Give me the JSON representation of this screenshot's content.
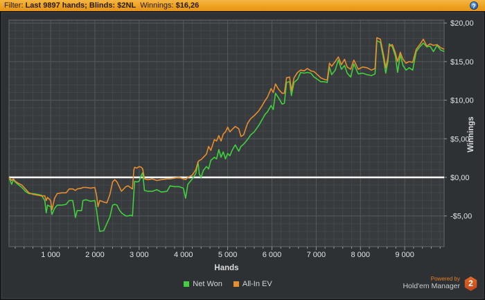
{
  "header": {
    "filter_label": "Filter: ",
    "filter_value": "Last 9897 hands; Blinds: $2NL",
    "winnings_label": "  Winnings: ",
    "winnings_value": "$16,26",
    "help_icon": "question-mark-icon",
    "bar_color": "#eda21f"
  },
  "chart_data": {
    "type": "line",
    "title": "",
    "xlabel": "Hands",
    "ylabel": "Winnings",
    "grid": true,
    "legend_position": "bottom",
    "xlim": [
      60,
      9890
    ],
    "ylim": [
      -9,
      20.4
    ],
    "x_ticks": [
      "1 000",
      "2 000",
      "3 000",
      "4 000",
      "5 000",
      "6 000",
      "7 000",
      "8 000",
      "9 000"
    ],
    "x_tick_values": [
      1000,
      2000,
      3000,
      4000,
      5000,
      6000,
      7000,
      8000,
      9000
    ],
    "y_ticks": [
      "$20,00",
      "$15,00",
      "$10,00",
      "$5,00",
      "$0,00",
      "-$5,00"
    ],
    "y_tick_values": [
      20,
      15,
      10,
      5,
      0,
      -5
    ],
    "zero_line_color": "#ffffff",
    "x": [
      60,
      120,
      160,
      200,
      280,
      350,
      430,
      510,
      600,
      700,
      790,
      870,
      900,
      930,
      1000,
      1030,
      1090,
      1150,
      1250,
      1350,
      1420,
      1500,
      1530,
      1560,
      1600,
      1700,
      1730,
      1800,
      1900,
      2000,
      2040,
      2070,
      2110,
      2200,
      2270,
      2340,
      2400,
      2450,
      2500,
      2550,
      2600,
      2650,
      2700,
      2750,
      2800,
      2850,
      2880,
      2900,
      2950,
      3000,
      3050,
      3080,
      3120,
      3200,
      3300,
      3400,
      3500,
      3630,
      3700,
      3800,
      3900,
      4000,
      4050,
      4100,
      4200,
      4280,
      4330,
      4360,
      4400,
      4450,
      4520,
      4570,
      4620,
      4700,
      4750,
      4800,
      4850,
      4900,
      4950,
      5000,
      5050,
      5100,
      5170,
      5250,
      5300,
      5360,
      5450,
      5520,
      5600,
      5700,
      5780,
      5850,
      5900,
      5980,
      6030,
      6080,
      6150,
      6230,
      6280,
      6330,
      6400,
      6440,
      6500,
      6580,
      6650,
      6730,
      6800,
      6880,
      6950,
      7030,
      7100,
      7180,
      7250,
      7300,
      7350,
      7430,
      7500,
      7570,
      7640,
      7700,
      7780,
      7850,
      7950,
      8050,
      8150,
      8250,
      8330,
      8370,
      8450,
      8530,
      8570,
      8620,
      8650,
      8720,
      8790,
      8840,
      8900,
      8960,
      9030,
      9100,
      9180,
      9260,
      9340,
      9420,
      9500,
      9570,
      9650,
      9730,
      9810,
      9890
    ],
    "series": [
      {
        "name": "Net Won",
        "color": "#41d13d",
        "values": [
          0.0,
          -0.9,
          -0.3,
          -0.6,
          -1.0,
          -1.3,
          -1.8,
          -2.1,
          -2.1,
          -2.2,
          -2.3,
          -3.0,
          -4.6,
          -3.6,
          -3.8,
          -4.8,
          -4.0,
          -3.6,
          -3.6,
          -3.5,
          -3.0,
          -3.0,
          -4.0,
          -5.2,
          -4.3,
          -4.3,
          -3.0,
          -2.9,
          -3.1,
          -3.0,
          -4.3,
          -5.6,
          -7.0,
          -6.9,
          -6.0,
          -5.1,
          -3.6,
          -3.5,
          -3.6,
          -4.2,
          -4.6,
          -4.8,
          -5.0,
          -5.0,
          -4.9,
          -5.0,
          -2.0,
          -0.5,
          -0.6,
          -0.5,
          0.3,
          0.6,
          -1.7,
          -1.8,
          -1.8,
          -1.6,
          -1.9,
          -1.8,
          -1.1,
          -1.2,
          -1.2,
          -1.4,
          -2.7,
          -0.9,
          -0.2,
          0.5,
          2.0,
          0.4,
          0.0,
          0.9,
          1.4,
          1.1,
          2.2,
          2.6,
          2.4,
          3.6,
          2.6,
          3.3,
          2.4,
          3.1,
          2.8,
          3.5,
          4.2,
          3.4,
          4.0,
          4.3,
          4.9,
          5.5,
          5.9,
          6.7,
          7.5,
          8.2,
          8.5,
          9.3,
          8.8,
          10.9,
          10.3,
          9.5,
          9.6,
          12.3,
          12.4,
          10.6,
          12.3,
          12.7,
          13.6,
          13.5,
          13.6,
          13.5,
          13.0,
          12.7,
          12.4,
          12.4,
          12.3,
          14.3,
          13.3,
          13.9,
          15.2,
          14.0,
          14.5,
          13.5,
          13.0,
          14.7,
          13.4,
          13.5,
          13.3,
          13.2,
          13.4,
          17.7,
          17.5,
          15.1,
          13.5,
          15.0,
          17.3,
          16.9,
          15.7,
          13.6,
          15.9,
          14.5,
          13.9,
          14.2,
          13.9,
          16.3,
          16.9,
          17.4,
          16.9,
          17.0,
          16.3,
          17.1,
          16.5,
          16.3
        ]
      },
      {
        "name": "All-In EV",
        "color": "#e78e2e",
        "values": [
          0.0,
          -0.4,
          -0.2,
          -0.5,
          -0.8,
          -1.0,
          -1.5,
          -2.0,
          -2.2,
          -2.3,
          -2.4,
          -2.4,
          -3.0,
          -2.6,
          -3.0,
          -4.2,
          -2.7,
          -2.1,
          -2.0,
          -2.0,
          -1.5,
          -1.5,
          -1.6,
          -1.7,
          -1.5,
          -1.4,
          -1.3,
          -1.3,
          -1.4,
          -1.3,
          -2.4,
          -3.8,
          -3.0,
          -3.2,
          -3.3,
          -2.2,
          -0.6,
          -0.3,
          -0.6,
          -1.2,
          -1.8,
          -1.5,
          -1.2,
          -1.1,
          -1.3,
          -1.5,
          1.0,
          1.3,
          1.2,
          1.4,
          1.3,
          1.1,
          -0.2,
          -0.3,
          -0.2,
          -0.4,
          -0.3,
          -0.2,
          -0.2,
          -0.1,
          0.0,
          -0.2,
          -0.3,
          0.0,
          0.3,
          1.0,
          2.0,
          2.2,
          2.3,
          2.6,
          3.0,
          4.0,
          3.5,
          4.9,
          4.7,
          5.4,
          4.7,
          5.6,
          5.9,
          6.5,
          5.9,
          6.2,
          6.6,
          6.3,
          5.3,
          5.5,
          7.0,
          7.6,
          8.0,
          8.6,
          9.3,
          10.0,
          10.4,
          11.5,
          11.0,
          12.1,
          11.4,
          10.9,
          10.9,
          12.9,
          13.0,
          11.2,
          12.9,
          13.6,
          13.9,
          13.8,
          14.1,
          13.8,
          13.7,
          13.3,
          12.9,
          12.7,
          12.6,
          14.8,
          14.4,
          15.0,
          15.6,
          14.6,
          15.3,
          14.3,
          14.0,
          15.2,
          14.0,
          14.3,
          14.2,
          13.9,
          14.1,
          18.1,
          17.9,
          15.6,
          14.2,
          15.5,
          17.0,
          17.2,
          16.1,
          15.0,
          16.2,
          15.3,
          14.8,
          15.0,
          14.9,
          16.6,
          17.2,
          17.9,
          17.0,
          17.3,
          17.1,
          17.2,
          16.8,
          16.6
        ]
      }
    ]
  },
  "footer": {
    "powered_by": "Powered by",
    "brand": "Hold'em Manager",
    "badge": "2"
  },
  "colors": {
    "panel_bg": "#2e3134",
    "plot_bg": "#383b3e",
    "grid_minor": "#42464a",
    "grid_major": "#54585c",
    "axis_text": "#e2e4e6",
    "zero_line": "#ffffff"
  }
}
